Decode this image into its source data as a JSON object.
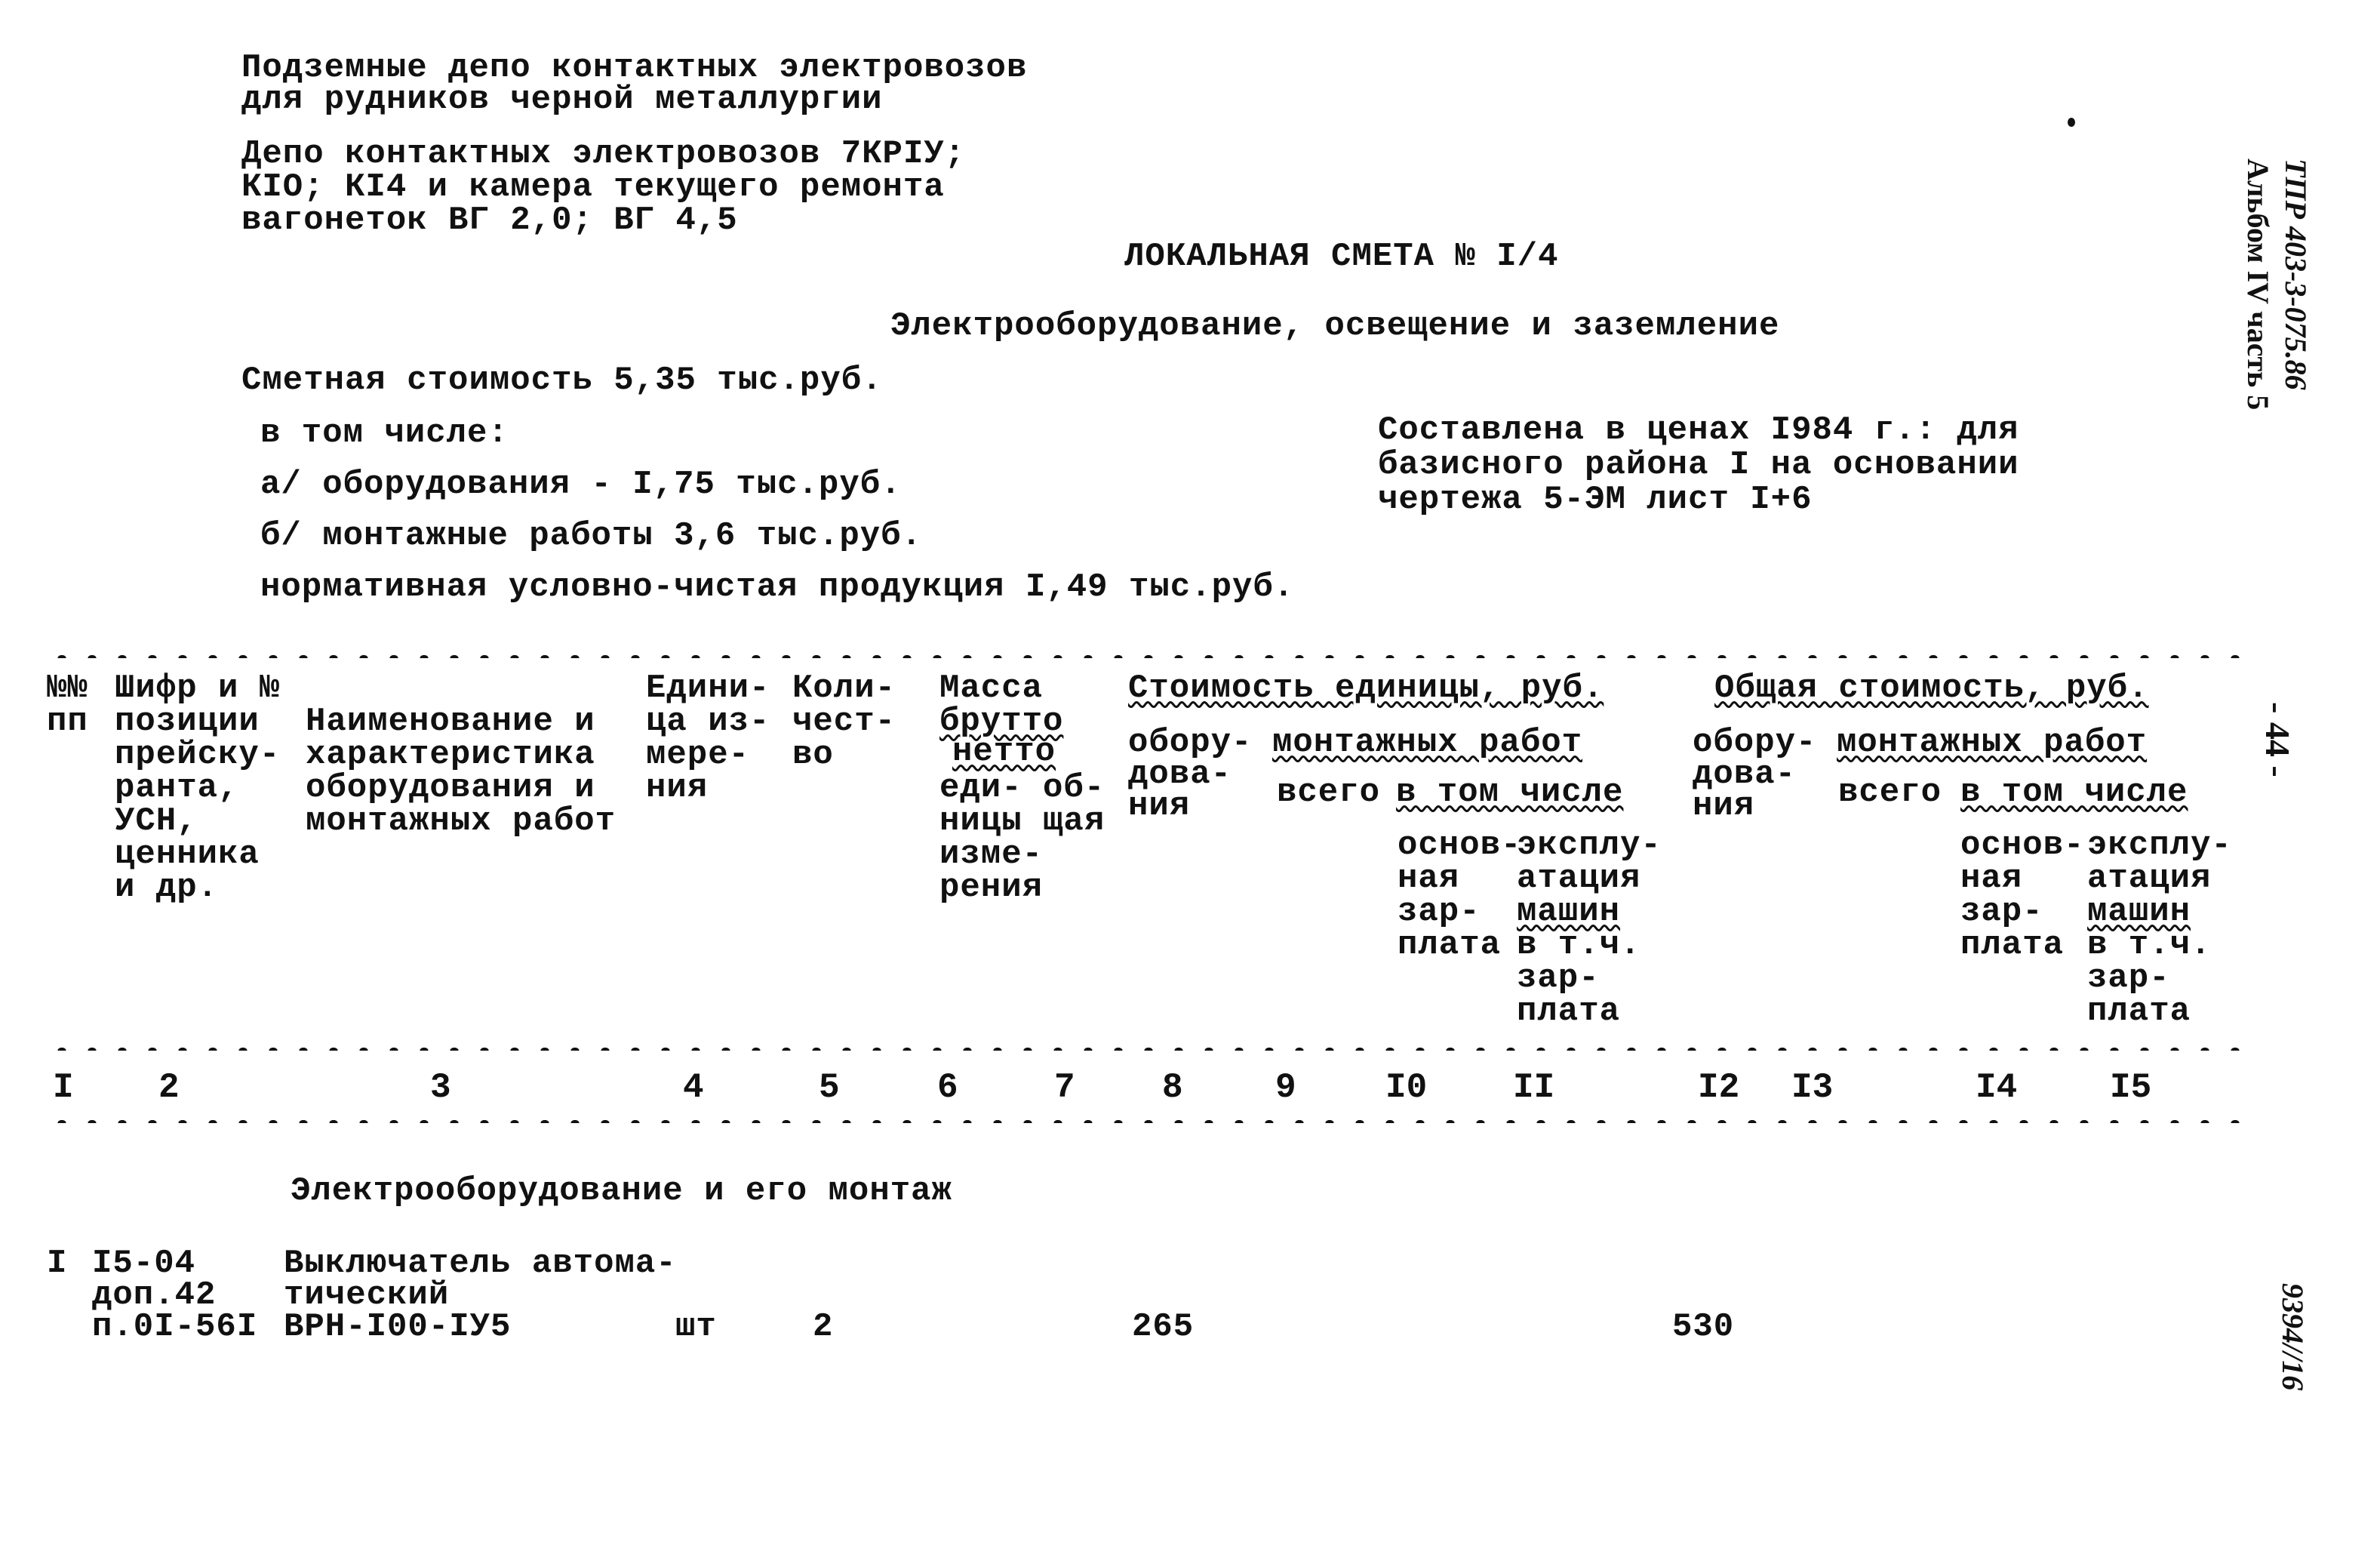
{
  "header": {
    "project_title": [
      "Подземные депо контактных электровозов",
      "для рудников черной металлургии"
    ],
    "object_title": [
      "Депо контактных электровозов 7КРIУ;",
      "КIО; КI4 и камера текущего ремонта",
      "вагонеток ВГ 2,0; ВГ 4,5"
    ],
    "doc_title": "ЛОКАЛЬНАЯ СМЕТА № I/4",
    "doc_subtitle": "Электрооборудование, освещение и заземление"
  },
  "summary": {
    "estimated_cost": "Сметная стоимость 5,35 тыс.руб.",
    "including": "в том числе:",
    "equipment": "а/ оборудования - I,75 тыс.руб.",
    "installation": "б/ монтажные работы 3,6 тыс.руб.",
    "net_product": "нормативная условно-чистая продукция I,49 тыс.руб."
  },
  "basis_note": [
    "Составлена в ценах I984 г.: для",
    "базисного района I на основании",
    "чертежа 5-ЭМ лист I+6"
  ],
  "margin": {
    "album_line1": "ТПР 403-3-075.86",
    "album_line2": "Альбом IV часть 5",
    "page_number": "- 44 -",
    "archive_number": "9394//16"
  },
  "table": {
    "col_headers": {
      "c1": [
        "№№",
        "пп"
      ],
      "c2": [
        "Шифр и №",
        "позиции",
        "прейску-",
        "ранта,",
        "УСН,",
        "ценника",
        "и др."
      ],
      "c3": [
        "Наименование и",
        "характеристика",
        "оборудования и",
        "монтажных работ"
      ],
      "c4": [
        "Едини-",
        "ца из-",
        "мере-",
        "ния"
      ],
      "c5": [
        "Коли-",
        "чест-",
        "во"
      ],
      "mass_title": "Масса",
      "mass_gross": "брутто",
      "mass_net": "нетто",
      "mass_sub": [
        "еди- об-",
        "ницы щая",
        "изме-",
        "рения"
      ],
      "unit_cost_title": "Стоимость единицы, руб.",
      "total_cost_title": "Общая стоимость, руб.",
      "equipment": [
        "обору-",
        "дова-",
        "ния"
      ],
      "installation_title": "монтажных работ",
      "total": "всего",
      "including": "в том числе",
      "base_salary": [
        "основ-",
        "ная",
        "зар-",
        "плата"
      ],
      "machines": [
        "эксплу-",
        "атация",
        "машин",
        "в т.ч.",
        "зар-",
        "плата"
      ]
    },
    "col_numbers": [
      "I",
      "2",
      "3",
      "4",
      "5",
      "6",
      "7",
      "8",
      "9",
      "I0",
      "II",
      "I2",
      "I3",
      "I4",
      "I5"
    ],
    "section_title": "Электрооборудование и его монтаж",
    "rows": [
      {
        "num": "I",
        "code": [
          "I5-04",
          "доп.42",
          "п.0I-56I"
        ],
        "name": [
          "Выключатель автома-",
          "тический",
          "ВРН-I00-IУ5"
        ],
        "unit": "шт",
        "qty": "2",
        "unit_equipment_cost": "265",
        "total_equipment_cost": "530"
      }
    ]
  }
}
